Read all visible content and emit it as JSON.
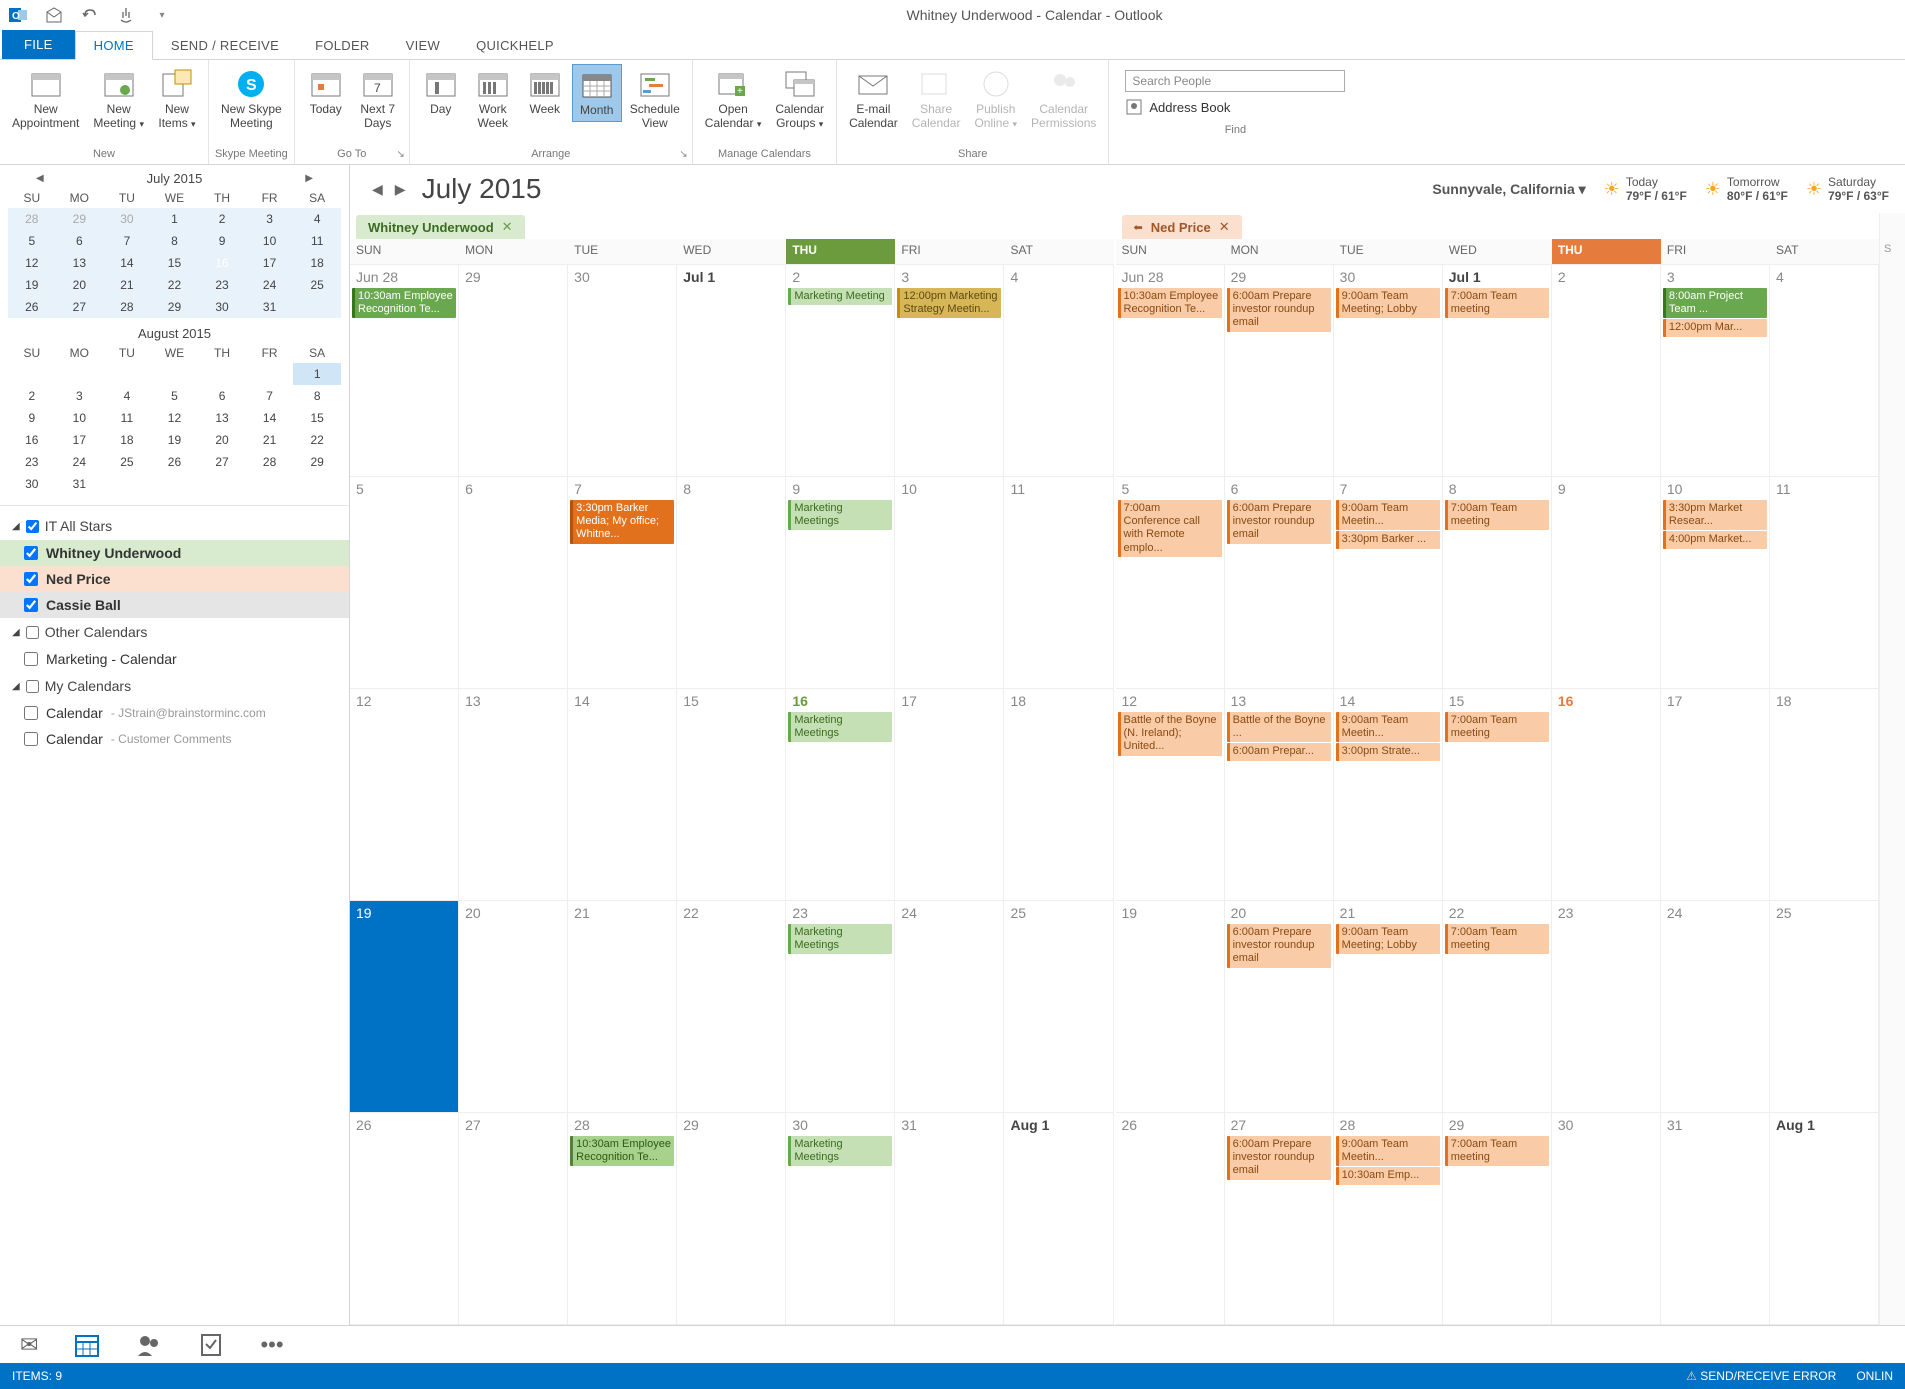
{
  "titlebar": {
    "title": "Whitney Underwood - Calendar - Outlook"
  },
  "tabs": {
    "file": "FILE",
    "home": "HOME",
    "sendreceive": "SEND / RECEIVE",
    "folder": "FOLDER",
    "view": "VIEW",
    "quickhelp": "QUICKHELP"
  },
  "ribbon": {
    "new_appointment": "New\nAppointment",
    "new_meeting": "New\nMeeting",
    "new_items": "New\nItems",
    "group_new": "New",
    "skype_meeting": "New Skype\nMeeting",
    "group_skype": "Skype Meeting",
    "today": "Today",
    "next7": "Next 7\nDays",
    "group_goto": "Go To",
    "day": "Day",
    "workweek": "Work\nWeek",
    "week": "Week",
    "month": "Month",
    "schedule": "Schedule\nView",
    "group_arrange": "Arrange",
    "open_cal": "Open\nCalendar",
    "cal_groups": "Calendar\nGroups",
    "group_manage": "Manage Calendars",
    "email_cal": "E-mail\nCalendar",
    "share_cal": "Share\nCalendar",
    "publish": "Publish\nOnline",
    "permissions": "Calendar\nPermissions",
    "group_share": "Share",
    "search_placeholder": "Search People",
    "address_book": "Address Book",
    "group_find": "Find"
  },
  "minical1": {
    "title": "July 2015",
    "dow": [
      "SU",
      "MO",
      "TU",
      "WE",
      "TH",
      "FR",
      "SA"
    ],
    "rows": [
      [
        "28",
        "29",
        "30",
        "1",
        "2",
        "3",
        "4"
      ],
      [
        "5",
        "6",
        "7",
        "8",
        "9",
        "10",
        "11"
      ],
      [
        "12",
        "13",
        "14",
        "15",
        "16",
        "17",
        "18"
      ],
      [
        "19",
        "20",
        "21",
        "22",
        "23",
        "24",
        "25"
      ],
      [
        "26",
        "27",
        "28",
        "29",
        "30",
        "31",
        ""
      ]
    ]
  },
  "minical2": {
    "title": "August 2015",
    "dow": [
      "SU",
      "MO",
      "TU",
      "WE",
      "TH",
      "FR",
      "SA"
    ],
    "rows": [
      [
        "",
        "",
        "",
        "",
        "",
        "",
        "1"
      ],
      [
        "2",
        "3",
        "4",
        "5",
        "6",
        "7",
        "8"
      ],
      [
        "9",
        "10",
        "11",
        "12",
        "13",
        "14",
        "15"
      ],
      [
        "16",
        "17",
        "18",
        "19",
        "20",
        "21",
        "22"
      ],
      [
        "23",
        "24",
        "25",
        "26",
        "27",
        "28",
        "29"
      ],
      [
        "30",
        "31",
        "",
        "",
        "",
        "",
        ""
      ]
    ]
  },
  "cal_list": {
    "g1": "IT All Stars",
    "i_wu": "Whitney Underwood",
    "i_np": "Ned Price",
    "i_cb": "Cassie Ball",
    "g2": "Other Calendars",
    "i_mkt": "Marketing - Calendar",
    "g3": "My Calendars",
    "i_c1": "Calendar",
    "i_c1s": "- JStrain@brainstorminc.com",
    "i_c2": "Calendar",
    "i_c2s": "- Customer Comments"
  },
  "hdr": {
    "month": "July 2015",
    "loc": "Sunnyvale, California",
    "w1l": "Today",
    "w1t": "79°F / 61°F",
    "w2l": "Tomorrow",
    "w2t": "80°F / 61°F",
    "w3l": "Saturday",
    "w3t": "79°F / 63°F"
  },
  "coltabs": {
    "wu": "Whitney Underwood",
    "np": "Ned Price"
  },
  "dows": [
    "SUN",
    "MON",
    "TUE",
    "WED",
    "THU",
    "FRI",
    "SAT"
  ],
  "stubdow": "S",
  "wu_grid": {
    "r0": {
      "d": [
        "Jun 28",
        "29",
        "30",
        "Jul 1",
        "2",
        "3",
        "4"
      ],
      "e": {
        "0": [
          {
            "c": "g1",
            "t": "10:30am Employee Recognition Te..."
          }
        ],
        "4": [
          {
            "c": "g2",
            "t": "Marketing Meeting"
          }
        ],
        "5": [
          {
            "c": "y1",
            "t": "12:00pm Marketing Strategy Meetin..."
          }
        ]
      }
    },
    "r1": {
      "d": [
        "5",
        "6",
        "7",
        "8",
        "9",
        "10",
        "11"
      ],
      "e": {
        "2": [
          {
            "c": "or-dk",
            "t": "3:30pm Barker Media; My office; Whitne..."
          }
        ],
        "4": [
          {
            "c": "g2",
            "t": "Marketing Meetings"
          }
        ]
      }
    },
    "r2": {
      "d": [
        "12",
        "13",
        "14",
        "15",
        "16",
        "17",
        "18"
      ],
      "e": {
        "4": [
          {
            "c": "g2",
            "t": "Marketing Meetings"
          }
        ]
      }
    },
    "r3": {
      "d": [
        "19",
        "20",
        "21",
        "22",
        "23",
        "24",
        "25"
      ],
      "e": {
        "4": [
          {
            "c": "g2",
            "t": "Marketing Meetings"
          }
        ]
      }
    },
    "r4": {
      "d": [
        "26",
        "27",
        "28",
        "29",
        "30",
        "31",
        "Aug 1"
      ],
      "e": {
        "2": [
          {
            "c": "g3",
            "t": "10:30am Employee Recognition Te..."
          }
        ],
        "4": [
          {
            "c": "g2",
            "t": "Marketing Meetings"
          }
        ]
      }
    }
  },
  "np_grid": {
    "r0": {
      "d": [
        "Jun 28",
        "29",
        "30",
        "Jul 1",
        "2",
        "3",
        "4"
      ],
      "e": {
        "0": [
          {
            "c": "o1",
            "t": "10:30am Employee Recognition Te..."
          }
        ],
        "1": [
          {
            "c": "o1",
            "t": "6:00am Prepare investor roundup email"
          }
        ],
        "2": [
          {
            "c": "o1",
            "t": "9:00am Team Meeting; Lobby"
          }
        ],
        "3": [
          {
            "c": "o1",
            "t": "7:00am Team meeting"
          }
        ],
        "5": [
          {
            "c": "o-grn",
            "t": "8:00am Project Team ..."
          },
          {
            "c": "o1",
            "t": "12:00pm Mar..."
          }
        ]
      }
    },
    "r1": {
      "d": [
        "5",
        "6",
        "7",
        "8",
        "9",
        "10",
        "11"
      ],
      "e": {
        "0": [
          {
            "c": "o1",
            "t": "7:00am Conference call with Remote emplo..."
          }
        ],
        "1": [
          {
            "c": "o1",
            "t": "6:00am Prepare investor roundup email"
          }
        ],
        "2": [
          {
            "c": "o1",
            "t": "9:00am Team Meetin..."
          },
          {
            "c": "o1",
            "t": "3:30pm Barker ..."
          }
        ],
        "3": [
          {
            "c": "o1",
            "t": "7:00am Team meeting"
          }
        ],
        "5": [
          {
            "c": "o1",
            "t": "3:30pm Market Resear..."
          },
          {
            "c": "o1",
            "t": "4:00pm Market..."
          }
        ]
      }
    },
    "r2": {
      "d": [
        "12",
        "13",
        "14",
        "15",
        "16",
        "17",
        "18"
      ],
      "e": {
        "0": [
          {
            "c": "o1",
            "t": "Battle of the Boyne (N. Ireland); United..."
          }
        ],
        "1": [
          {
            "c": "o1",
            "t": "Battle of the Boyne ..."
          },
          {
            "c": "o1",
            "t": "6:00am Prepar..."
          }
        ],
        "2": [
          {
            "c": "o1",
            "t": "9:00am Team Meetin..."
          },
          {
            "c": "o1",
            "t": "3:00pm Strate..."
          }
        ],
        "3": [
          {
            "c": "o1",
            "t": "7:00am Team meeting"
          }
        ]
      }
    },
    "r3": {
      "d": [
        "19",
        "20",
        "21",
        "22",
        "23",
        "24",
        "25"
      ],
      "e": {
        "1": [
          {
            "c": "o1",
            "t": "6:00am Prepare investor roundup email"
          }
        ],
        "2": [
          {
            "c": "o1",
            "t": "9:00am Team Meeting; Lobby"
          }
        ],
        "3": [
          {
            "c": "o1",
            "t": "7:00am Team meeting"
          }
        ]
      }
    },
    "r4": {
      "d": [
        "26",
        "27",
        "28",
        "29",
        "30",
        "31",
        "Aug 1"
      ],
      "e": {
        "1": [
          {
            "c": "o1",
            "t": "6:00am Prepare investor roundup email"
          }
        ],
        "2": [
          {
            "c": "o1",
            "t": "9:00am Team Meetin..."
          },
          {
            "c": "o1",
            "t": "10:30am Emp..."
          }
        ],
        "3": [
          {
            "c": "o1",
            "t": "7:00am Team meeting"
          }
        ]
      }
    }
  },
  "status": {
    "items": "ITEMS: 9",
    "error": "SEND/RECEIVE ERROR",
    "online": "ONLIN"
  }
}
